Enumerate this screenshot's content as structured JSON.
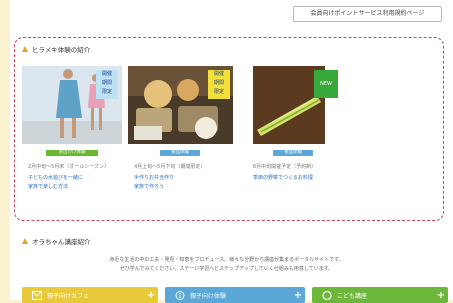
{
  "header": {
    "top_link": "会員向けポイントサービス利用規約ページ"
  },
  "featured": {
    "title": "ヒラメキ体験の紹介",
    "cards": [
      {
        "badge": [
          "開催",
          "期間",
          "限定"
        ],
        "category": "お出かけ体験",
        "meta": "2月中旬〜5月末（オールシーズン）",
        "links": [
          "子どもの水遊びを一緒に",
          "家族で楽しむ方法"
        ]
      },
      {
        "badge": [
          "開催",
          "期間",
          "限定"
        ],
        "category": "食品体験",
        "meta": "4月上旬〜5月下旬（期間限定）",
        "links": [
          "手作りお弁当作り",
          "家族で作ろう"
        ]
      },
      {
        "badge": [
          "NEW"
        ],
        "category": "食品体験",
        "meta": "6月中旬開催予定（予約制）",
        "links": [
          "季節の野菜でつくるお料理"
        ]
      }
    ]
  },
  "courses": {
    "title": "オラちゃん講座紹介",
    "intro": [
      "身近な生活の中の工夫・発見・知恵をプロデュース。様々な分野から講座が集まるポータルサイトです。",
      "ぜひ学んでみてください。ステージ学習へとステップアップしていく仕組みも用意しています。"
    ]
  },
  "buttons": [
    {
      "label": "親子向けカフェ",
      "color": "#e8c93a"
    },
    {
      "label": "親子向け体験",
      "color": "#5aa7d8"
    },
    {
      "label": "こども講座",
      "color": "#6db83a"
    }
  ],
  "colors": {
    "accent": "#e8a21b",
    "dashed_border": "#c8485a",
    "category": "#6ab62e"
  }
}
